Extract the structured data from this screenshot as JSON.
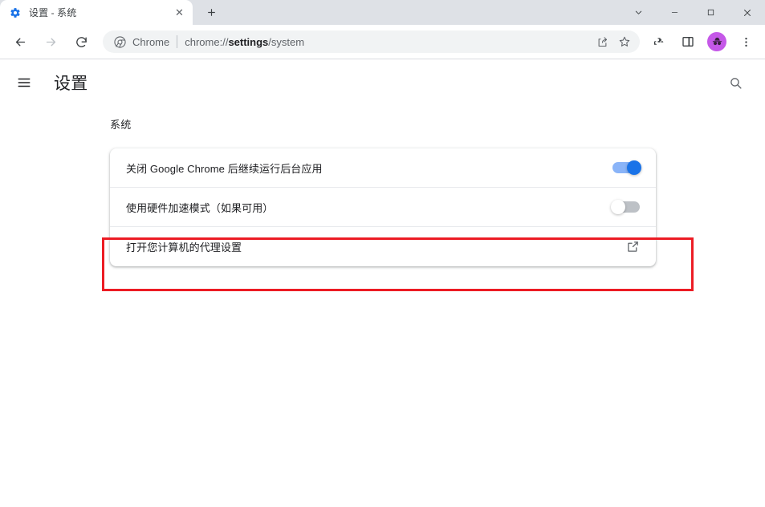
{
  "window": {
    "controls": {
      "tab_search": "chevron-down-icon",
      "minimize": "minimize-icon",
      "maximize": "maximize-icon",
      "close": "close-icon"
    }
  },
  "tabstrip": {
    "tabs": [
      {
        "title": "设置 - 系统",
        "favicon": "gear-icon",
        "close_label": "✕",
        "active": true
      }
    ],
    "new_tab_label": "+"
  },
  "toolbar": {
    "back_label": "back-arrow-icon",
    "forward_label": "forward-arrow-icon",
    "reload_label": "reload-icon",
    "omnibox": {
      "chip_icon": "chrome-icon",
      "chip_label": "Chrome",
      "url_prefix": "chrome://",
      "url_strong": "settings",
      "url_suffix": "/system",
      "share_icon": "share-icon",
      "bookmark_icon": "star-icon"
    },
    "extensions_icon": "puzzle-piece-icon",
    "side_panel_icon": "side-panel-icon",
    "profile_icon": "profile-avatar-icon",
    "menu_icon": "three-dot-menu-icon"
  },
  "settings": {
    "menu_label": "hamburger-menu-icon",
    "title": "设置",
    "search_label": "search-icon",
    "section_label": "系统",
    "rows": [
      {
        "label": "关闭 Google Chrome 后继续运行后台应用",
        "control": "toggle",
        "state": "on"
      },
      {
        "label": "使用硬件加速模式（如果可用）",
        "control": "toggle",
        "state": "off"
      },
      {
        "label": "打开您计算机的代理设置",
        "control": "external-link",
        "state": ""
      }
    ]
  },
  "annotation": {
    "type": "highlight-rectangle",
    "color": "#ec1c24",
    "target": "打开您计算机的代理设置"
  }
}
